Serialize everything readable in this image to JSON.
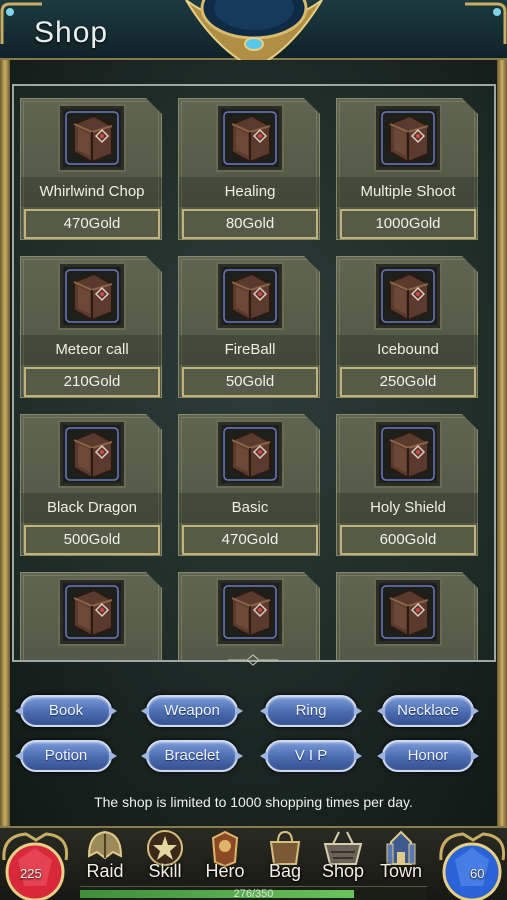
{
  "header": {
    "title": "Shop"
  },
  "shop_items": [
    {
      "name": "Whirlwind Chop",
      "price": "470Gold",
      "icon": "skill-book-icon"
    },
    {
      "name": "Healing",
      "price": "80Gold",
      "icon": "skill-book-icon"
    },
    {
      "name": "Multiple Shoot",
      "price": "1000Gold",
      "icon": "skill-book-icon"
    },
    {
      "name": "Meteor call",
      "price": "210Gold",
      "icon": "skill-book-icon"
    },
    {
      "name": "FireBall",
      "price": "50Gold",
      "icon": "skill-book-icon"
    },
    {
      "name": "Icebound",
      "price": "250Gold",
      "icon": "skill-book-icon"
    },
    {
      "name": "Black Dragon",
      "price": "500Gold",
      "icon": "skill-book-icon"
    },
    {
      "name": "Basic",
      "price": "470Gold",
      "icon": "skill-book-icon"
    },
    {
      "name": "Holy Shield",
      "price": "600Gold",
      "icon": "skill-book-icon"
    },
    {
      "icon": "skill-book-icon"
    },
    {
      "icon": "skill-book-icon"
    },
    {
      "icon": "skill-book-icon"
    }
  ],
  "categories": [
    {
      "label": "Book"
    },
    {
      "label": "Weapon"
    },
    {
      "label": "Ring"
    },
    {
      "label": "Necklace"
    },
    {
      "label": "Potion"
    },
    {
      "label": "Bracelet"
    },
    {
      "label": "V I P"
    },
    {
      "label": "Honor"
    }
  ],
  "notice": "The shop is limited to 1000 shopping times per day.",
  "status": {
    "red_orb_value": "225",
    "blue_orb_value": "60",
    "xp_text": "276/350",
    "xp_fraction": 0.789
  },
  "nav": [
    {
      "label": "Raid",
      "icon": "raid-helmet-icon"
    },
    {
      "label": "Skill",
      "icon": "skill-star-icon"
    },
    {
      "label": "Hero",
      "icon": "hero-armor-icon"
    },
    {
      "label": "Bag",
      "icon": "bag-icon"
    },
    {
      "label": "Shop",
      "icon": "shop-basket-icon"
    },
    {
      "label": "Town",
      "icon": "town-tower-icon"
    }
  ],
  "colors": {
    "card_bg": "#5f6550",
    "price_border": "#c2b27a",
    "button_blue": "#4d6fb3",
    "red_orb": "#d8283a",
    "blue_orb": "#2a63d8"
  }
}
